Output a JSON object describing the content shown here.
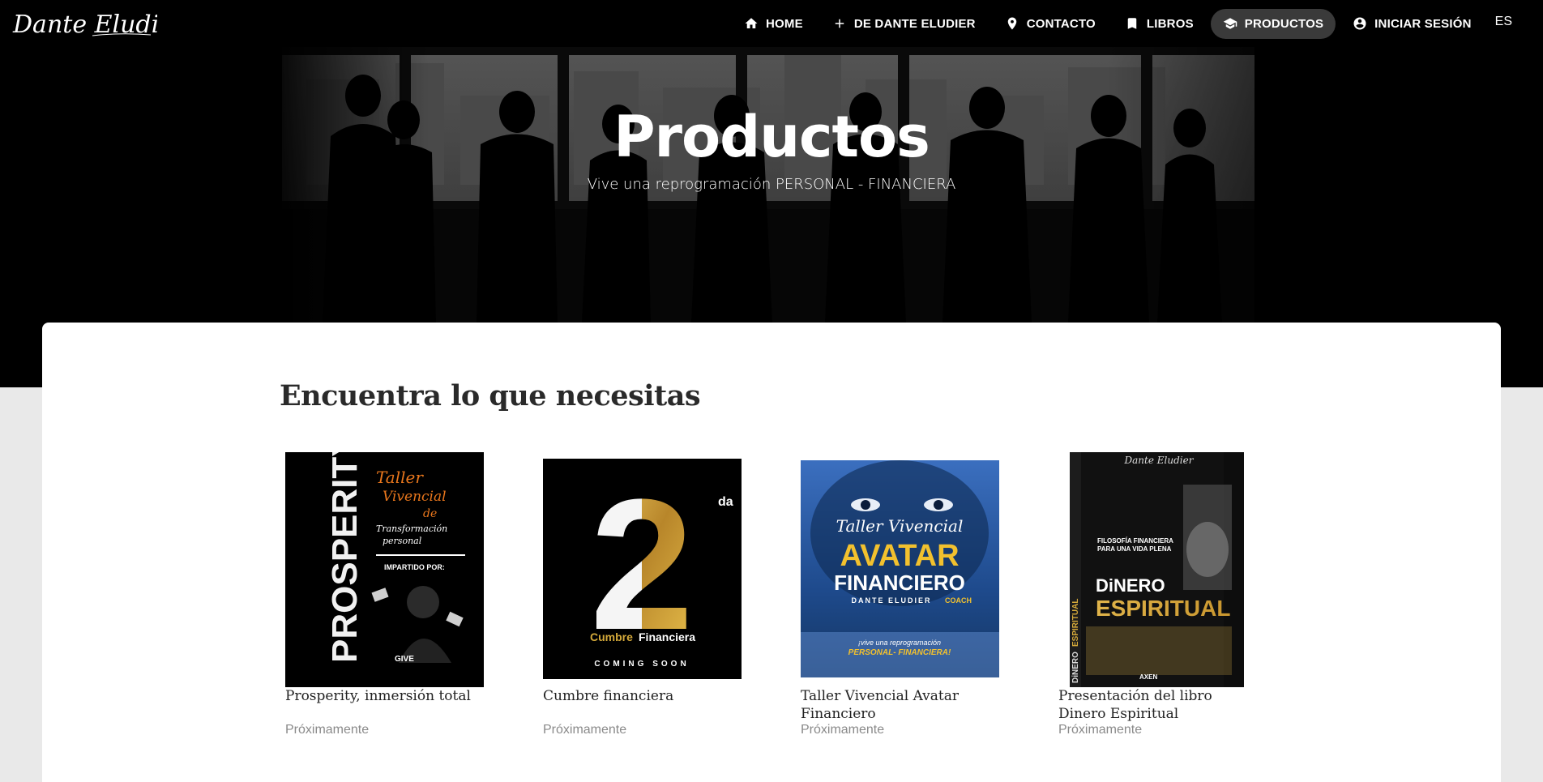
{
  "brand": {
    "logo_text": "Dante Eludier"
  },
  "nav": {
    "items": [
      {
        "label": "HOME",
        "icon": "home-icon"
      },
      {
        "label": "DE DANTE ELUDIER",
        "icon": "plus-icon"
      },
      {
        "label": "CONTACTO",
        "icon": "location-pin-icon"
      },
      {
        "label": "LIBROS",
        "icon": "bookmark-icon"
      },
      {
        "label": "PRODUCTOS",
        "icon": "graduation-cap-icon",
        "active": true
      },
      {
        "label": "INICIAR SESIÓN",
        "icon": "account-circle-icon"
      }
    ],
    "language": "ES"
  },
  "hero": {
    "title": "Productos",
    "subtitle": "Vive una reprogramación PERSONAL - FINANCIERA"
  },
  "section": {
    "title": "Encuentra lo que necesitas"
  },
  "products": [
    {
      "name": "Prosperity, inmersión total",
      "status": "Próximamente",
      "cover": {
        "vertical_word": "PROSPERITY",
        "script_line_1": "Taller",
        "script_line_2": "Vivencial",
        "script_line_3": "de",
        "script_line_4": "Transformación",
        "script_line_5": "personal",
        "byline": "IMPARTIDO POR:",
        "partner": "GIVE"
      }
    },
    {
      "name": "Cumbre financiera",
      "status": "Próximamente",
      "cover": {
        "big_number": "2",
        "ordinal": "da",
        "caption_1": "Cumbre",
        "caption_2": "Financiera",
        "footer": "COMING SOON"
      }
    },
    {
      "name": "Taller Vivencial Avatar Financiero",
      "status": "Próximamente",
      "cover": {
        "script_title": "Taller Vivencial",
        "line_1": "AVATAR",
        "line_2": "FINANCIERO",
        "author": "DANTE ELUDIER",
        "author_role": "COACH",
        "tagline_1": "¡vive una reprogramación",
        "tagline_2": "PERSONAL- FINANCIERA!"
      }
    },
    {
      "name": "Presentación del libro Dinero Espiritual",
      "status": "Próximamente",
      "cover": {
        "signature": "Dante Eludier",
        "tagline_1": "FILOSOFÍA FINANCIERA",
        "tagline_2": "PARA UNA VIDA PLENA",
        "title_1": "DiNERO",
        "title_2": "ESPIRITUAL",
        "spine_1": "DiNERO",
        "spine_2": "ESPIRITUAL",
        "publisher": "AXEN"
      }
    }
  ],
  "colors": {
    "nav_bg": "#000000",
    "active_pill": "#3a3a3a",
    "card_bg": "#ffffff",
    "page_bg": "#e9e9e9",
    "muted_text": "#8a8a8a",
    "accent_orange": "#e8761c",
    "accent_gold": "#d4a93a",
    "accent_yellow": "#f2c12e",
    "accent_blue": "#1e4a8c"
  }
}
